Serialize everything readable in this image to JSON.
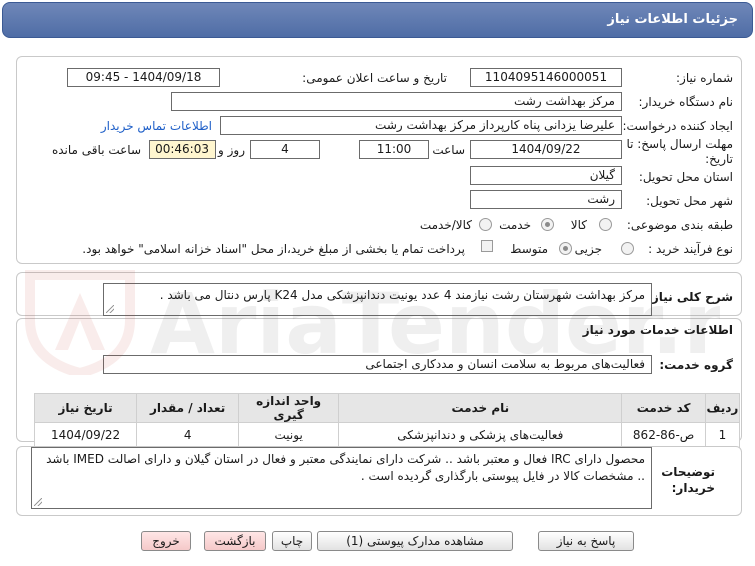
{
  "header": {
    "title": "جزئیات اطلاعات نیاز"
  },
  "info": {
    "need_number_label": "شماره نیاز:",
    "need_number": "1104095146000051",
    "announce_label": "تاریخ و ساعت اعلان عمومی:",
    "announce_value": "1404/09/18 - 09:45",
    "buyer_org_label": "نام دستگاه خریدار:",
    "buyer_org": "مرکز بهداشت رشت",
    "creator_label": "ایجاد کننده درخواست:",
    "creator": "علیرضا یزدانی پناه کارپرداز مرکز بهداشت رشت",
    "contact_link": "اطلاعات تماس خریدار",
    "deadline_label_1": "مهلت ارسال پاسخ: تا",
    "deadline_label_2": "تاریخ:",
    "deadline_date": "1404/09/22",
    "time_label": "ساعت",
    "deadline_time": "11:00",
    "days_value": "4",
    "days_label": "روز و",
    "remaining_time": "00:46:03",
    "remaining_label": "ساعت باقی مانده",
    "province_label": "استان محل تحویل:",
    "province": "گیلان",
    "city_label": "شهر محل تحویل:",
    "city": "رشت",
    "category_label": "طبقه بندی موضوعی:",
    "category_options": [
      "کالا",
      "خدمت",
      "کالا/خدمت"
    ],
    "category_selected": "خدمت",
    "process_label": "نوع فرآیند خرید :",
    "process_options": [
      "جزیی",
      "متوسط"
    ],
    "process_selected": "متوسط",
    "payment_note": "پرداخت تمام یا بخشی از مبلغ خرید،از محل \"اسناد خزانه اسلامی\" خواهد بود."
  },
  "description": {
    "label": "شرح کلی نیاز:",
    "text": "مرکز بهداشت شهرستان رشت نیازمند 4 عدد یونیت دندانپزشکی مدل K24 پارس دنتال می باشد ."
  },
  "services": {
    "section_title": "اطلاعات خدمات مورد نیاز",
    "group_label": "گروه خدمت:",
    "group_value": "فعالیت‌های مربوط به سلامت انسان و مددکاری اجتماعی",
    "columns": [
      "ردیف",
      "کد خدمت",
      "نام خدمت",
      "واحد اندازه گیری",
      "تعداد / مقدار",
      "تاریخ نیاز"
    ],
    "rows": [
      [
        "1",
        "ص-86-862",
        "فعالیت‌های پزشکی و دندانپزشکی",
        "یونیت",
        "4",
        "1404/09/22"
      ]
    ]
  },
  "buyer_notes": {
    "label_1": "توضیحات",
    "label_2": "خریدار:",
    "text": "محصول دارای IRC فعال و معتبر باشد .. شرکت دارای نمایندگی معتبر و فعال در استان گیلان و دارای اصالت IMED باشد .. مشخصات کالا در فایل پیوستی بارگذاری گردیده است ."
  },
  "buttons": {
    "reply": "پاسخ به نیاز",
    "attachments": "مشاهده مدارک پیوستی (1)",
    "print": "چاپ",
    "back": "بازگشت",
    "exit": "خروج"
  },
  "watermark": {
    "text": "AriaTender.net"
  }
}
